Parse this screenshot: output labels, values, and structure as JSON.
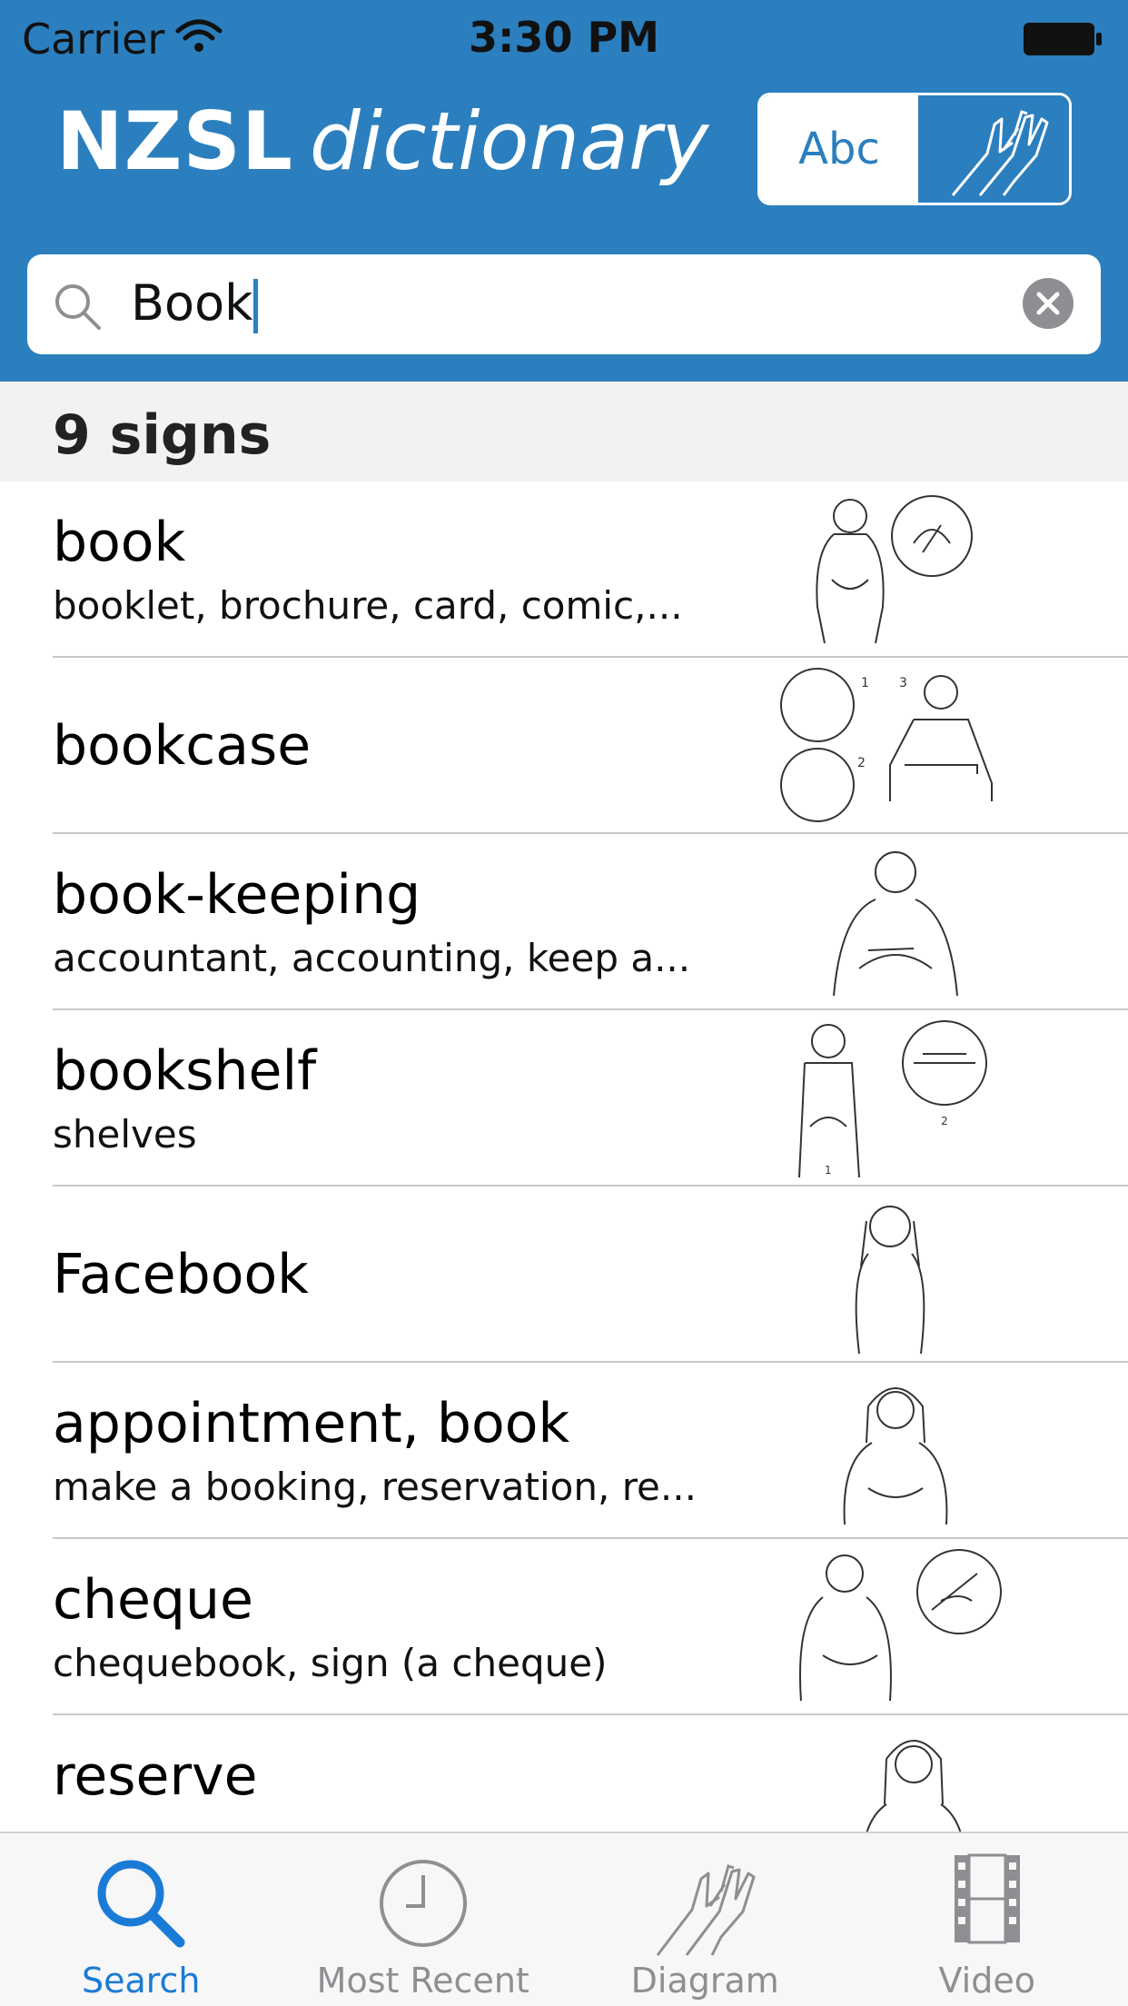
{
  "status_bar": {
    "carrier": "Carrier",
    "time": "3:30 PM"
  },
  "header": {
    "brand_strong": "NZSL",
    "brand_light": "dictionary",
    "mode_text": "Abc"
  },
  "search": {
    "query": "Book"
  },
  "results": {
    "count_label": "9 signs",
    "items": [
      {
        "gloss": "book",
        "minor": "booklet, brochure, card, comic,..."
      },
      {
        "gloss": "bookcase",
        "minor": ""
      },
      {
        "gloss": "book-keeping",
        "minor": "accountant, accounting, keep a..."
      },
      {
        "gloss": "bookshelf",
        "minor": "shelves"
      },
      {
        "gloss": "Facebook",
        "minor": ""
      },
      {
        "gloss": "appointment, book",
        "minor": "make a booking, reservation, re..."
      },
      {
        "gloss": "cheque",
        "minor": "chequebook, sign (a cheque)"
      },
      {
        "gloss": "reserve",
        "minor": ""
      }
    ]
  },
  "tabs": [
    {
      "label": "Search",
      "icon": "search-icon",
      "active": true
    },
    {
      "label": "Most Recent",
      "icon": "clock-icon",
      "active": false
    },
    {
      "label": "Diagram",
      "icon": "hands-icon",
      "active": false
    },
    {
      "label": "Video",
      "icon": "film-icon",
      "active": false
    }
  ],
  "colors": {
    "brand_blue": "#2b7fbe",
    "tab_active": "#1a7bd6",
    "tab_inactive": "#8e8e93"
  }
}
